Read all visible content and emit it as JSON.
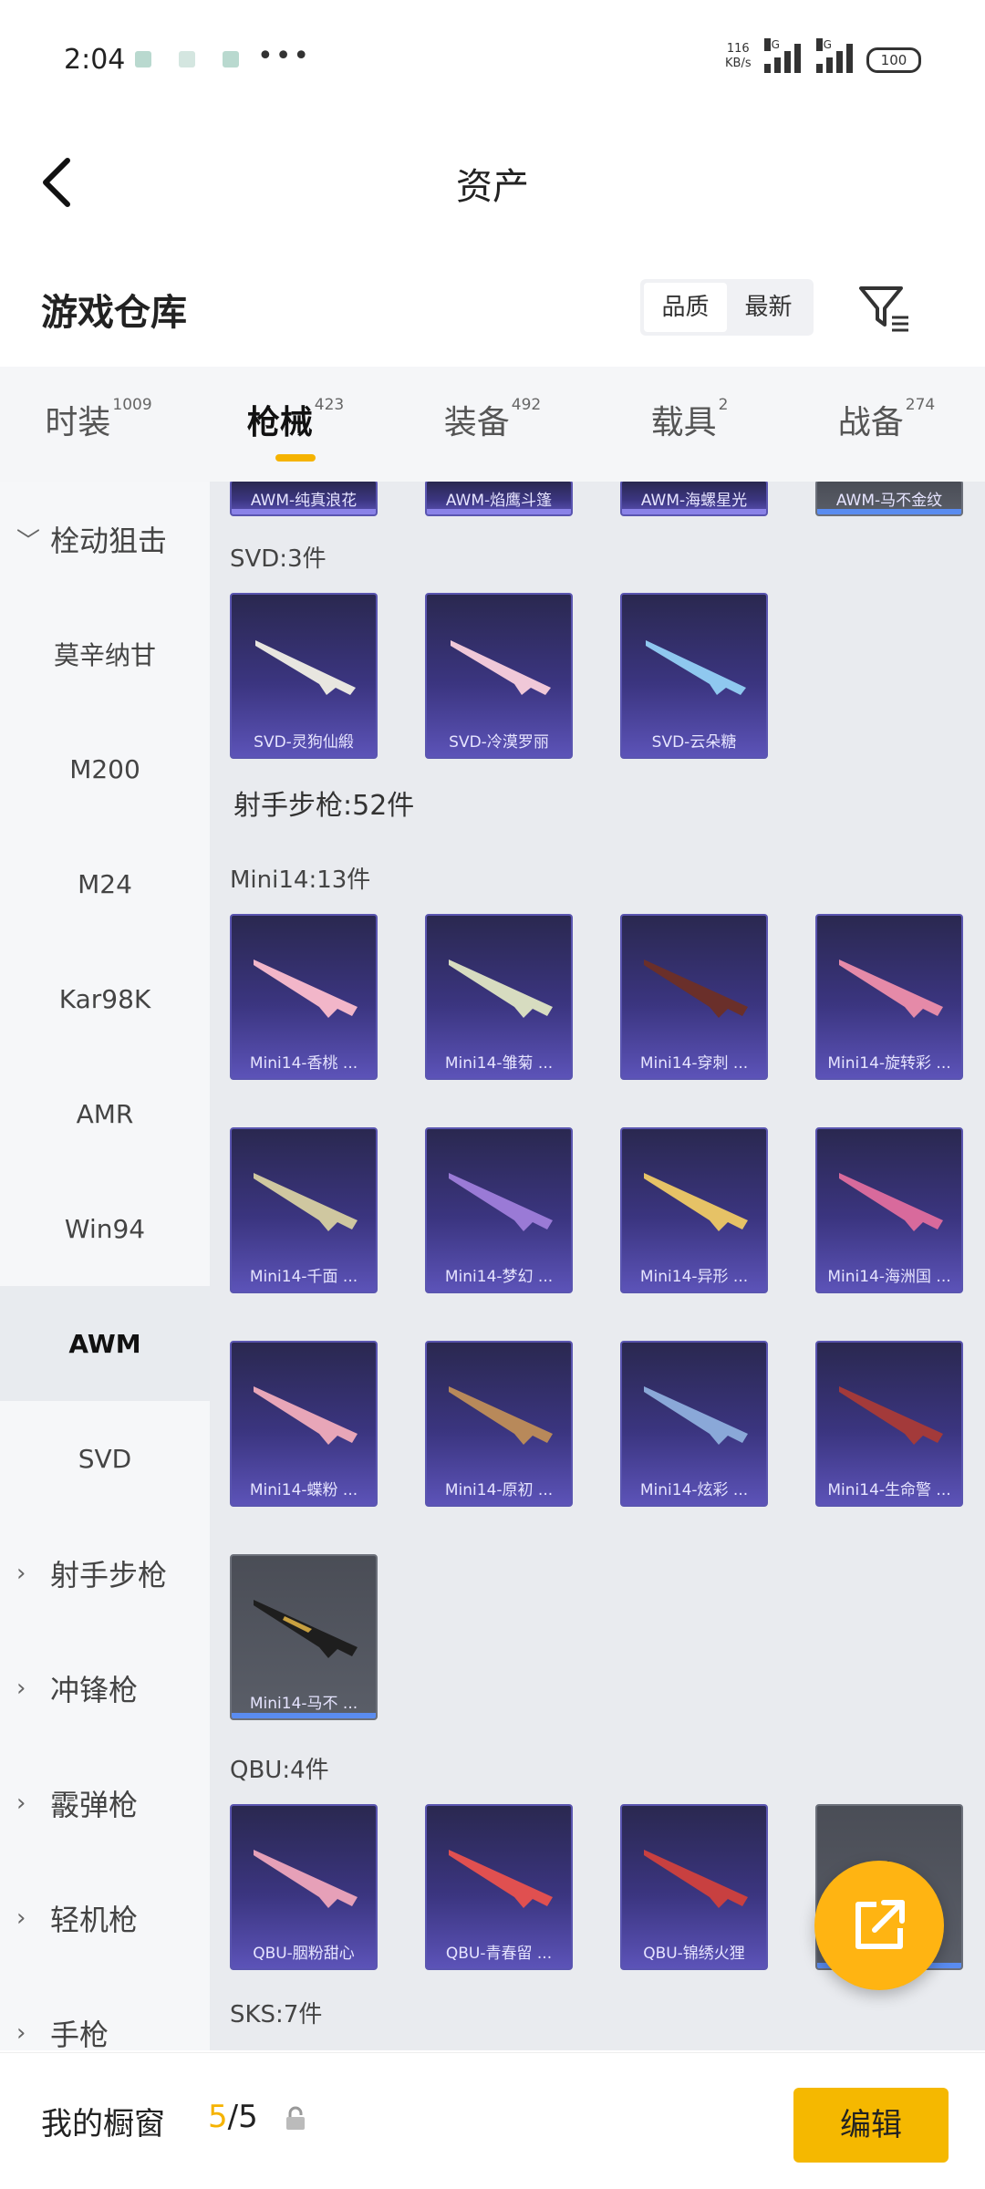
{
  "status": {
    "time": "2:04",
    "net_speed_value": "116",
    "net_speed_unit": "KB/s",
    "net_type_1": "5G",
    "net_type_2": "5G",
    "battery": "100"
  },
  "header": {
    "title": "资产"
  },
  "warehouse": {
    "title": "游戏仓库",
    "sort_quality": "品质",
    "sort_latest": "最新"
  },
  "tabs": [
    {
      "label": "时装",
      "count": "1009"
    },
    {
      "label": "枪械",
      "count": "423"
    },
    {
      "label": "装备",
      "count": "492"
    },
    {
      "label": "载具",
      "count": "2"
    },
    {
      "label": "战备",
      "count": "274"
    }
  ],
  "sidebar": {
    "group_bolt": "栓动狙击",
    "items": [
      "莫辛纳甘",
      "M200",
      "M24",
      "Kar98K",
      "AMR",
      "Win94",
      "AWM",
      "SVD"
    ],
    "groups": [
      "射手步枪",
      "冲锋枪",
      "霰弹枪",
      "轻机枪",
      "手枪"
    ]
  },
  "content": {
    "top_cards": [
      "AWM-纯真浪花",
      "AWM-焰鹰斗篷",
      "AWM-海螺星光",
      "AWM-马不金纹"
    ],
    "svd_title": "SVD:3件",
    "svd_cards": [
      "SVD-灵狗仙緞",
      "SVD-冷漠罗丽",
      "SVD-云朵糖"
    ],
    "marksman_title": "射手步枪:52件",
    "mini14_title": "Mini14:13件",
    "mini14_cards": [
      "Mini14-香桃 ...",
      "Mini14-雏菊 ...",
      "Mini14-穿刺 ...",
      "Mini14-旋转彩 ...",
      "Mini14-千面 ...",
      "Mini14-梦幻 ...",
      "Mini14-异形 ...",
      "Mini14-海洲国 ...",
      "Mini14-蝶粉 ...",
      "Mini14-原初 ...",
      "Mini14-炫彩 ...",
      "Mini14-生命警 ...",
      "Mini14-马不 ..."
    ],
    "qbu_title": "QBU:4件",
    "qbu_cards": [
      "QBU-胭粉甜心",
      "QBU-青春留 ...",
      "QBU-锦绣火狸",
      ""
    ],
    "sks_title": "SKS:7件"
  },
  "bottom": {
    "label": "我的橱窗",
    "count_current": "5",
    "count_sep_total": "/5",
    "edit": "编辑"
  }
}
